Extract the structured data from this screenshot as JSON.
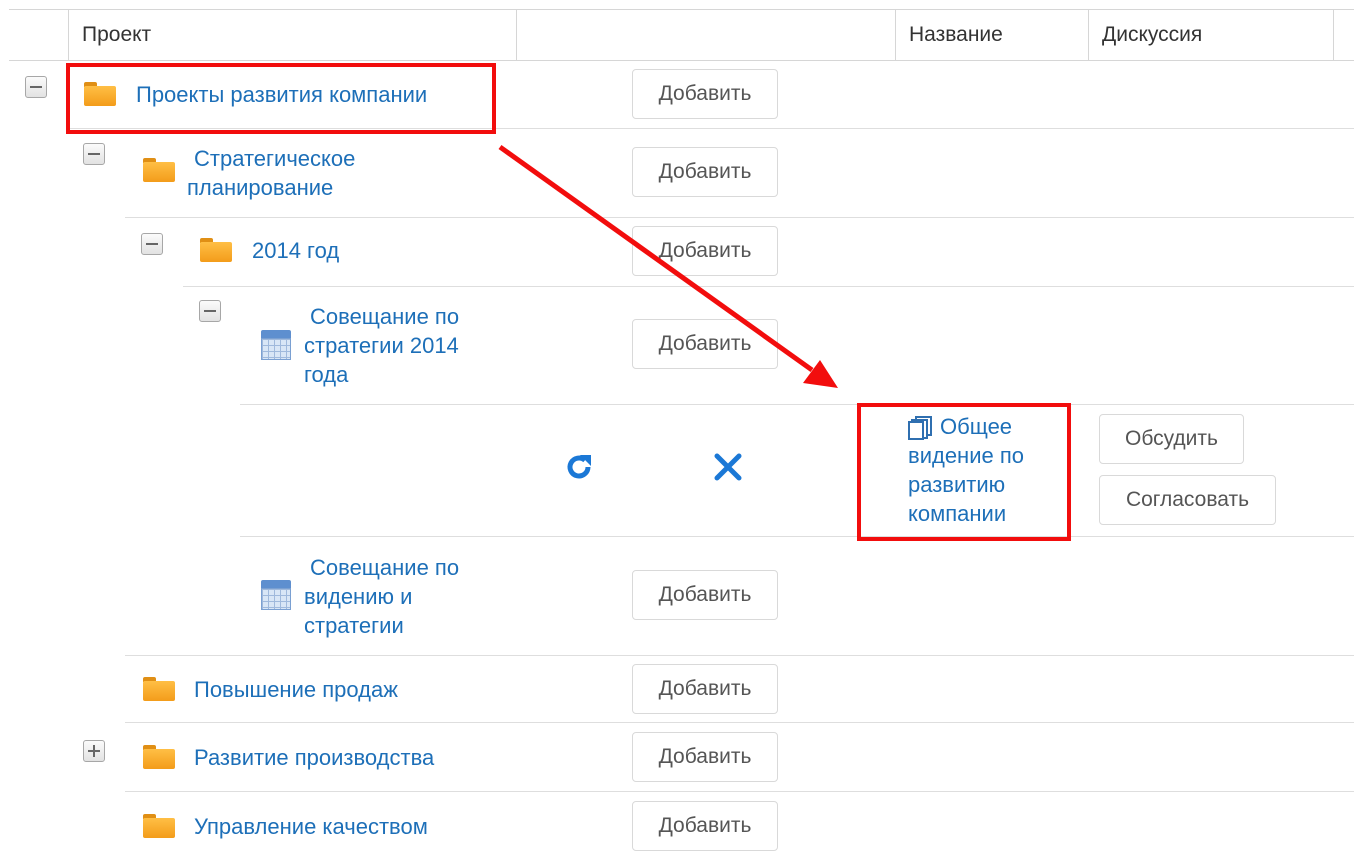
{
  "table": {
    "headers": {
      "project": "Проект",
      "empty": "",
      "name": "Название",
      "discussion": "Дискуссия"
    }
  },
  "rows": {
    "r1": {
      "label": "Проекты развития компании",
      "add": "Добавить"
    },
    "r2": {
      "label_line1": "Стратегическое",
      "label_line2": "планирование",
      "add": "Добавить"
    },
    "r3": {
      "label": "2014 год",
      "add": "Добавить"
    },
    "r4": {
      "label_line1": "Совещание по",
      "label_line2": "стратегии 2014",
      "label_line3": "года",
      "add": "Добавить"
    },
    "r5": {
      "doc_line1": "Общее",
      "doc_line2": "видение по",
      "doc_line3": "развитию",
      "doc_line4": "компании",
      "discuss": "Обсудить",
      "approve": "Согласовать"
    },
    "r6": {
      "label_line1": "Совещание по",
      "label_line2": "видению и",
      "label_line3": "стратегии",
      "add": "Добавить"
    },
    "r7": {
      "label": "Повышение продаж",
      "add": "Добавить"
    },
    "r8": {
      "label": "Развитие производства",
      "add": "Добавить"
    },
    "r9": {
      "label": "Управление качеством",
      "add": "Добавить"
    }
  },
  "icons": {
    "folder": "folder-icon",
    "calendar": "calendar-icon",
    "document": "document-copy-icon",
    "refresh": "refresh-icon",
    "delete": "close-icon",
    "collapse": "minus-icon",
    "expand": "plus-icon"
  },
  "colors": {
    "link": "#1d6fb8",
    "highlight": "#f20d0d",
    "folder": "#f7a928"
  }
}
